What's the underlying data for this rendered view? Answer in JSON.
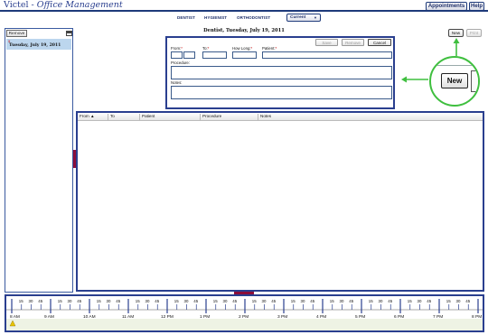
{
  "header": {
    "app_name": "Victel",
    "app_separator": " - ",
    "app_subtitle": "Office Management",
    "appointments_label": "Appointments",
    "help_label": "Help"
  },
  "roles": {
    "tabs": [
      "DENTIST",
      "HYGIENIST",
      "ORTHODONTIST"
    ],
    "selected_view": "Current"
  },
  "left_panel": {
    "remove_label": "Remove",
    "date_marker": "x",
    "date_label": "Tuesday, July 19, 2011"
  },
  "form": {
    "title": "Dentist, Tuesday, July 19, 2011",
    "save_label": "Save",
    "remove_label": "Remove",
    "cancel_label": "Cancel",
    "from_label": "From:",
    "to_label": "To:",
    "how_long_label": "How Long:",
    "patient_label": "Patient:",
    "required_mark": "*",
    "procedure_label": "Procedure:",
    "notes_label": "Notes:"
  },
  "actions": {
    "new_label": "New",
    "print_label": "Print",
    "zoom_new_label": "New"
  },
  "grid": {
    "columns": [
      "From ▲",
      "To",
      "Patient",
      "Procedure",
      "Notes"
    ]
  },
  "timeline": {
    "hour_labels": [
      "8 AM",
      "9 AM",
      "10 AM",
      "11 AM",
      "12 PM",
      "1 PM",
      "2 PM",
      "3 PM",
      "4 PM",
      "5 PM",
      "6 PM",
      "7 PM",
      "8 PM"
    ],
    "minute_labels": [
      "15",
      "30",
      "45"
    ]
  },
  "colors": {
    "accent": "#2a3f8f",
    "callout": "#3fbf3f",
    "splitter": "#8b0d3a",
    "selected_date": "#bcd6ee"
  }
}
